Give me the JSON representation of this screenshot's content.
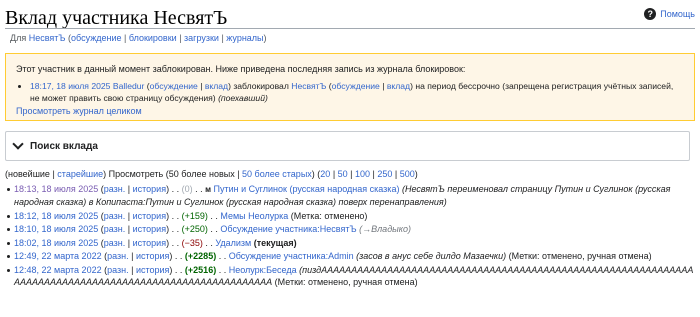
{
  "header": {
    "title": "Вклад участника НесвятЪ",
    "help_label": "Помощь",
    "help_glyph": "?"
  },
  "subtitle": {
    "prefix": "Для ",
    "user": "НесвятЪ",
    "open": " (",
    "talk": "обсуждение",
    "sep1": " | ",
    "blocks": "блокировки",
    "sep2": " | ",
    "uploads": "загрузки",
    "sep3": " | ",
    "logs": "журналы",
    "close": ")"
  },
  "block_notice": {
    "text": "Этот участник в данный момент заблокирован. Ниже приведена последняя запись из журнала блокировок:",
    "entry": {
      "time": "18:17, 18 июля 2025",
      "admin": "Balledur",
      "admin_talk": "обсуждение",
      "admin_contrib": "вклад",
      "action": " заблокировал ",
      "target": "НесвятЪ",
      "target_talk": "обсуждение",
      "target_contrib": "вклад",
      "rest": " на период бессрочно (запрещена регистрация учётных записей, не может править свою страницу обсуждения) ",
      "reason": "(поехавший)"
    },
    "log_link": "Просмотреть журнал целиком"
  },
  "search": {
    "label": "Поиск вклада",
    "icon": "chevron-down-icon"
  },
  "pager": {
    "open": "(",
    "newest": "новейшие",
    "sep": " | ",
    "oldest": "старейшие",
    "mid": ") Просмотреть (50 более новых | ",
    "older": "50 более старых",
    "close1": ") (",
    "n20": "20",
    "n50": "50",
    "n100": "100",
    "n250": "250",
    "n500": "500",
    "close2": ")"
  },
  "contributions": [
    {
      "time": "18:13, 18 июля 2025",
      "diff": "разн.",
      "hist": "история",
      "size": "(0)",
      "minor": "м",
      "page": "Путин и Суглинок (русская народная сказка)",
      "summary": "(НесвятЪ переименовал страницу Путин и Суглинок (русская народная сказка) в Копипаста:Путин и Суглинок (русская народная сказка) поверх перенаправления)"
    },
    {
      "time": "18:12, 18 июля 2025",
      "diff": "разн.",
      "hist": "история",
      "size": "(+159)",
      "page": "Мемы Неолурка",
      "tags": "(Метка: отменено)"
    },
    {
      "time": "18:10, 18 июля 2025",
      "diff": "разн.",
      "hist": "история",
      "size": "(+250)",
      "page": "Обсуждение участника:НесвятЪ",
      "summary": "(→Владыко)"
    },
    {
      "time": "18:02, 18 июля 2025",
      "diff": "разн.",
      "hist": "история",
      "size": "(−35)",
      "page": "Удализм",
      "current": "(текущая)"
    },
    {
      "time": "12:49, 22 марта 2022",
      "diff": "разн.",
      "hist": "история",
      "size": "(+2285)",
      "page": "Обсуждение участника:Admin",
      "summary": "(засов в анус себе дилдо Мазаечки)",
      "tags": "(Метки: отменено, ручная отмена)"
    },
    {
      "time": "12:48, 22 марта 2022",
      "diff": "разн.",
      "hist": "история",
      "size": "(+2516)",
      "page": "Неолурк:Беседа",
      "summary": "(пиздААААААААААААААААААААААААААААААААААААААААААААААААААААААААААААААААААААААААААААААААААААААААААААААААААААААААА",
      "tags": "(Метки: отменено, ручная отмена)"
    }
  ]
}
